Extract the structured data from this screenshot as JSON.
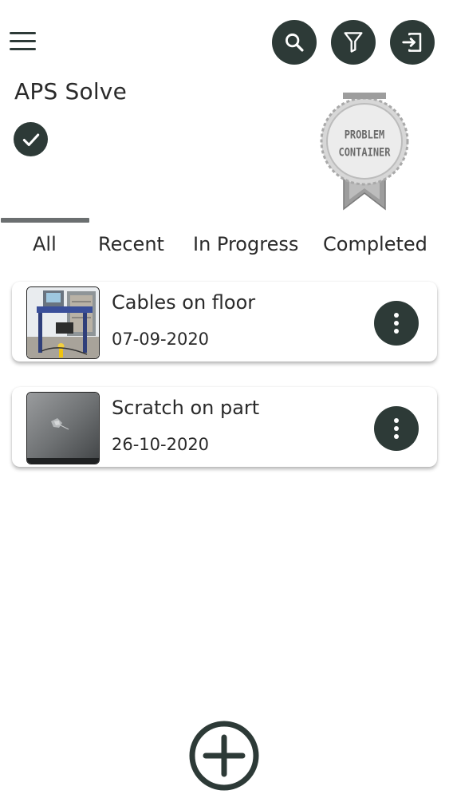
{
  "header": {
    "app_title": "APS Solve",
    "menu_icon": "hamburger-menu-icon",
    "actions": {
      "search_icon": "search-icon",
      "filter_icon": "filter-icon",
      "logout_icon": "logout-icon"
    }
  },
  "badge": {
    "line1": "PROBLEM",
    "line2": "CONTAINER"
  },
  "tabs": [
    {
      "label": "All",
      "active": true
    },
    {
      "label": "Recent",
      "active": false
    },
    {
      "label": "In Progress",
      "active": false
    },
    {
      "label": "Completed",
      "active": false
    }
  ],
  "problems": [
    {
      "title": "Cables on floor",
      "date": "07-09-2020",
      "thumbnail": "factory-cables-photo"
    },
    {
      "title": "Scratch on part",
      "date": "26-10-2020",
      "thumbnail": "scratched-metal-photo"
    }
  ],
  "fab": {
    "icon": "plus-circle-icon"
  },
  "colors": {
    "primary_dark": "#2d3a37",
    "tab_indicator": "#6b6f70",
    "text": "#2a2a2a",
    "background": "#ffffff"
  }
}
